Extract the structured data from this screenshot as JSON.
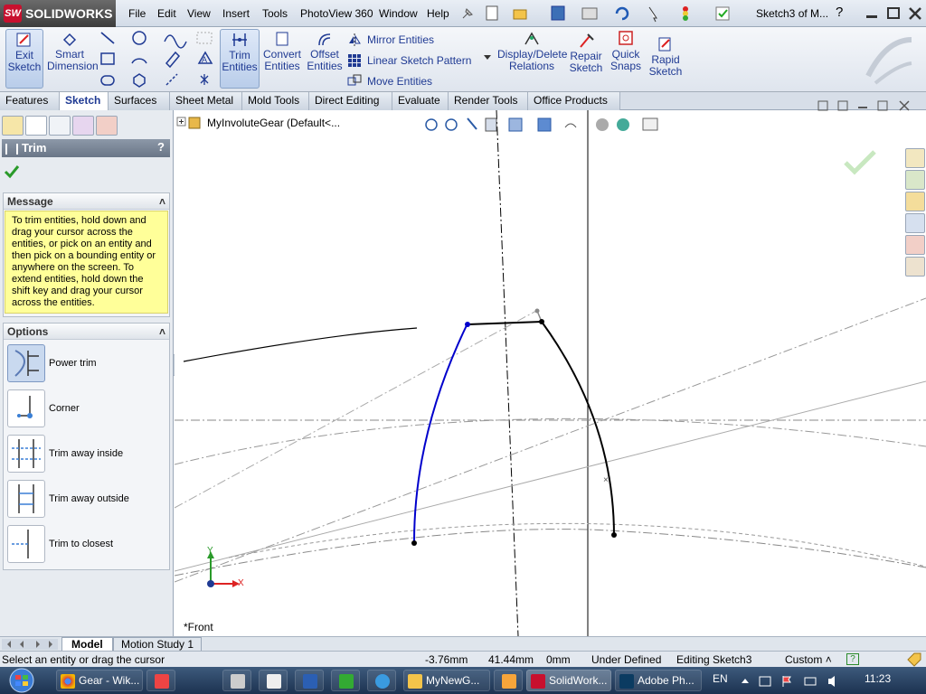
{
  "app": {
    "brand": "SOLIDWORKS",
    "logo_mark": "SW",
    "doc_title": "Sketch3 of M...",
    "help": "?"
  },
  "menu": [
    "File",
    "Edit",
    "View",
    "Insert",
    "Tools",
    "PhotoView 360",
    "Window",
    "Help"
  ],
  "ribbon": {
    "exit_sketch": "Exit\nSketch",
    "smart_dimension": "Smart\nDimension",
    "trim_entities": "Trim\nEntities",
    "convert_entities": "Convert\nEntities",
    "offset_entities": "Offset\nEntities",
    "mirror_entities": "Mirror Entities",
    "linear_pattern": "Linear Sketch Pattern",
    "move_entities": "Move Entities",
    "display_delete": "Display/Delete\nRelations",
    "repair_sketch": "Repair\nSketch",
    "quick_snaps": "Quick\nSnaps",
    "rapid_sketch": "Rapid\nSketch"
  },
  "tabs": [
    "Features",
    "Sketch",
    "Surfaces",
    "Sheet Metal",
    "Mold Tools",
    "Direct Editing",
    "Evaluate",
    "Render Tools",
    "Office Products"
  ],
  "active_tab": "Sketch",
  "panel": {
    "title": "Trim",
    "help": "?",
    "message_header": "Message",
    "message": "To trim entities, hold down and drag your cursor across the entities, or pick on an entity and then pick on a bounding entity or anywhere on the screen.  To extend entities, hold down the shift key and drag your cursor across the entities.",
    "options_header": "Options",
    "options": [
      "Power trim",
      "Corner",
      "Trim away inside",
      "Trim away outside",
      "Trim to closest"
    ],
    "selected_option": "Power trim"
  },
  "tree": {
    "expand": "+",
    "label": "MyInvoluteGear  (Default<..."
  },
  "viewport": {
    "view_label": "*Front",
    "axis_x": "X",
    "axis_y": "Y"
  },
  "model_tabs": [
    "Model",
    "Motion Study 1"
  ],
  "status": {
    "prompt": "Select an entity or drag the cursor",
    "x": "-3.76mm",
    "y": "41.44mm",
    "z": "0mm",
    "state": "Under Defined",
    "editing": "Editing Sketch3",
    "units": "Custom"
  },
  "taskbar": {
    "items": [
      "Gear - Wik...",
      "MyNewG...",
      "SolidWork...",
      "Adobe Ph..."
    ],
    "lang": "EN",
    "time": "11:23"
  },
  "colors": {
    "accent": "#1f3a93",
    "curve_blue": "#0000cc",
    "message_bg": "#ffff99"
  }
}
